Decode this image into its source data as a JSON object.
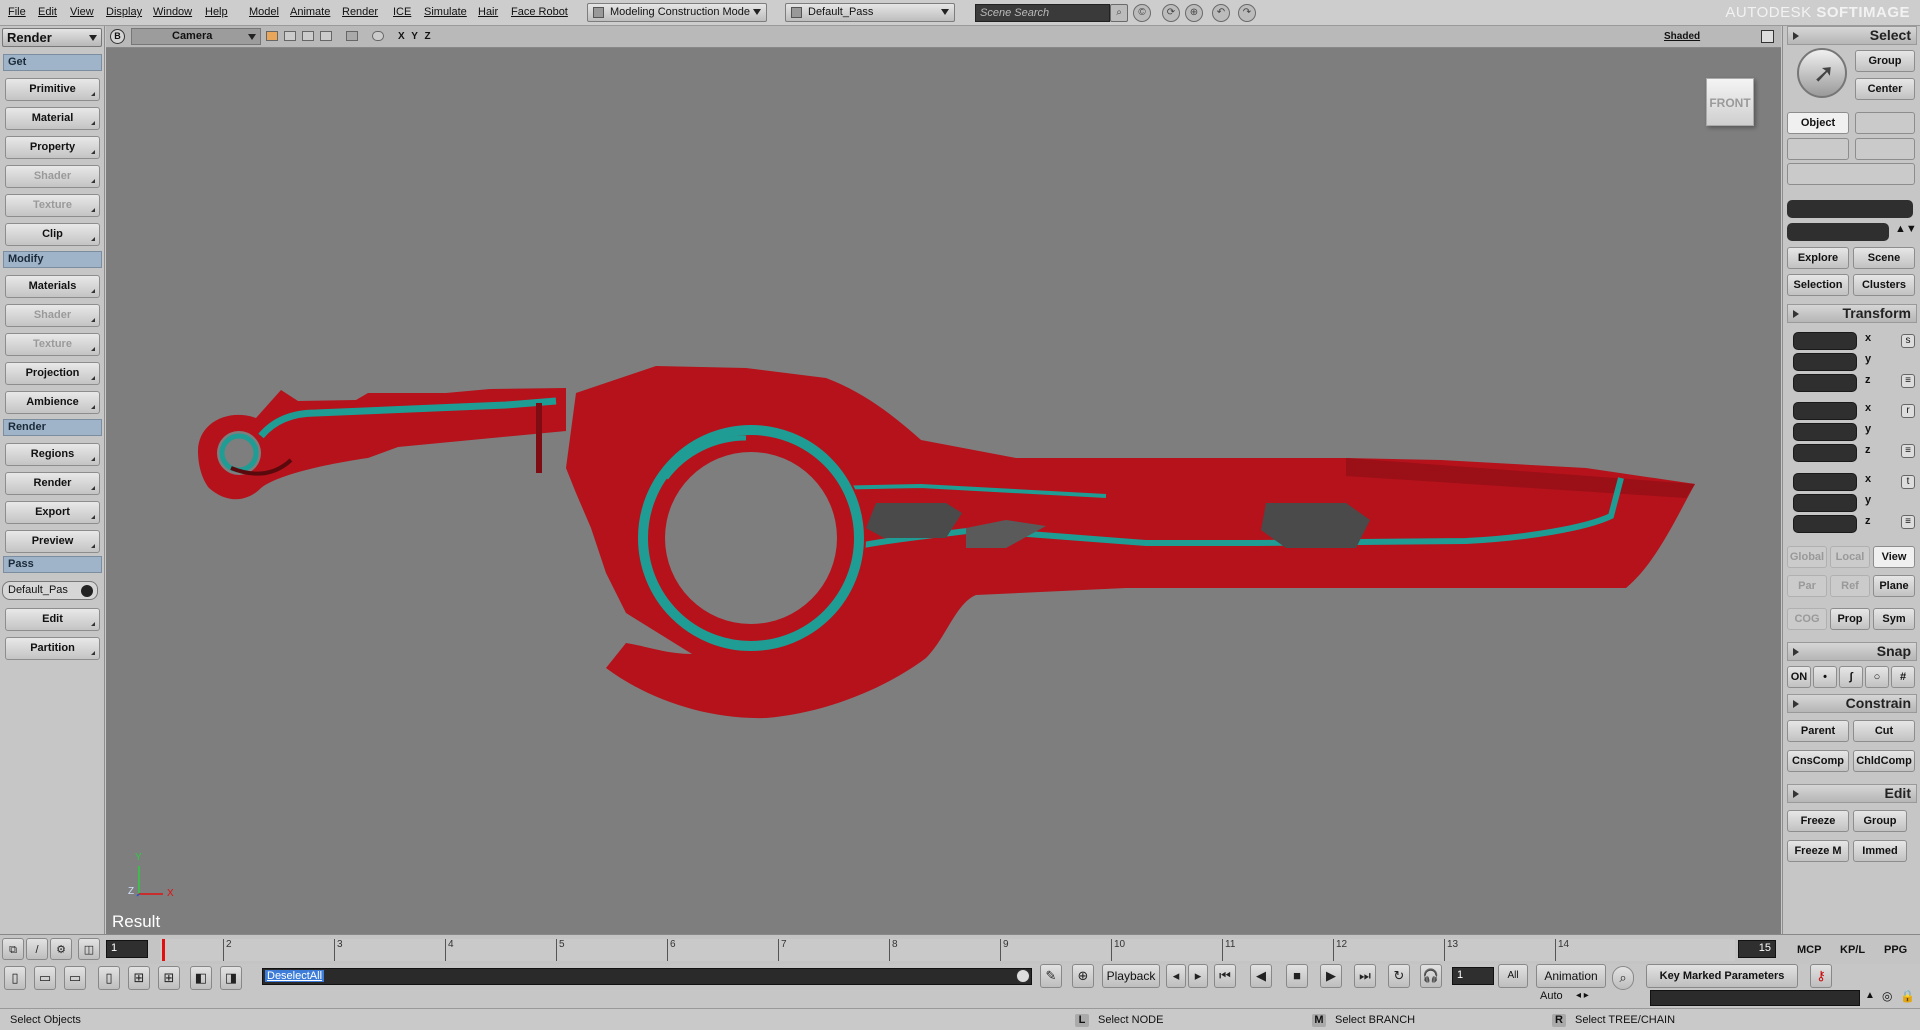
{
  "menu": [
    "File",
    "Edit",
    "View",
    "Display",
    "Window",
    "Help",
    "Model",
    "Animate",
    "Render",
    "ICE",
    "Simulate",
    "Hair",
    "Face Robot"
  ],
  "toolbar": {
    "construction_mode": "Modeling Construction Mode",
    "pass": "Default_Pass",
    "search_placeholder": "Scene Search",
    "brand_prefix": "AUTODESK",
    "brand_name": "SOFTIMAGE"
  },
  "left": {
    "toolbar_name": "Render",
    "sections": {
      "get": "Get",
      "modify": "Modify",
      "render": "Render",
      "pass": "Pass"
    },
    "get_buttons": [
      "Primitive",
      "Material",
      "Property",
      "Shader",
      "Texture",
      "Clip"
    ],
    "modify_buttons": [
      "Materials",
      "Shader",
      "Texture",
      "Projection",
      "Ambience"
    ],
    "render_buttons": [
      "Regions",
      "Render",
      "Export",
      "Preview"
    ],
    "pass_value": "Default_Pas",
    "pass_buttons": [
      "Edit",
      "Partition"
    ]
  },
  "viewport": {
    "view_letter": "B",
    "camera": "Camera",
    "axes_label": "X Y Z",
    "shading": "Shaded",
    "cube_label": "FRONT",
    "result": "Result",
    "gizmo": {
      "y": "Y",
      "z": "Z",
      "x": "X"
    }
  },
  "right": {
    "select": {
      "title": "Select",
      "group": "Group",
      "center": "Center",
      "object": "Object",
      "explore": "Explore",
      "scene": "Scene",
      "selection": "Selection",
      "clusters": "Clusters"
    },
    "transform": {
      "title": "Transform",
      "x": "x",
      "y": "y",
      "z": "z",
      "global": "Global",
      "local": "Local",
      "view": "View",
      "par": "Par",
      "ref": "Ref",
      "plane": "Plane",
      "cog": "COG",
      "prop": "Prop",
      "sym": "Sym"
    },
    "snap": {
      "title": "Snap",
      "on": "ON"
    },
    "constrain": {
      "title": "Constrain",
      "parent": "Parent",
      "cut": "Cut",
      "cnscomp": "CnsComp",
      "chldcomp": "ChldComp"
    },
    "edit": {
      "title": "Edit",
      "freeze": "Freeze",
      "group": "Group",
      "freezem": "Freeze M",
      "immed": "Immed"
    }
  },
  "timeline": {
    "start_frame": "1",
    "ticks": [
      "1",
      "2",
      "3",
      "4",
      "5",
      "6",
      "7",
      "8",
      "9",
      "10",
      "11",
      "12",
      "13",
      "14"
    ],
    "end_frame": "15",
    "tabs": [
      "MCP",
      "KP/L",
      "PPG"
    ]
  },
  "command": {
    "text": "DeselectAll",
    "playback": "Playback",
    "current_frame": "1",
    "all": "All",
    "animation": "Animation",
    "auto": "Auto",
    "key_marked": "Key Marked Parameters"
  },
  "status": {
    "main": "Select Objects",
    "l_key": "L",
    "l_text": "Select NODE",
    "m_key": "M",
    "m_text": "Select BRANCH",
    "r_key": "R",
    "r_text": "Select TREE/CHAIN"
  },
  "colors": {
    "model_red": "#b5121b",
    "model_teal": "#1f9c94",
    "model_gray": "#4a4a4a"
  }
}
